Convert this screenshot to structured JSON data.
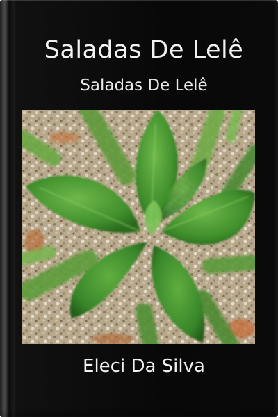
{
  "book": {
    "title": "Saladas De Lelê",
    "subtitle": "Saladas De Lelê",
    "author": "Eleci Da Silva",
    "cover_color": "#0a0a0a",
    "text_color": "#f2f2f2",
    "cover_image": "basil-sprout-photo"
  }
}
